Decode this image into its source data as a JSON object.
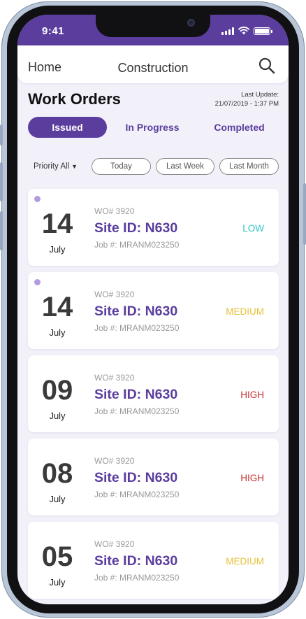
{
  "status_bar": {
    "time": "9:41"
  },
  "header": {
    "home": "Home",
    "title": "Construction"
  },
  "page": {
    "title": "Work Orders",
    "last_update_label": "Last Update:",
    "last_update_value": "21/07/2019 - 1:37 PM"
  },
  "tabs": [
    {
      "label": "Issued",
      "active": true
    },
    {
      "label": "In Progress",
      "active": false
    },
    {
      "label": "Completed",
      "active": false
    }
  ],
  "filters": {
    "priority_label": "Priority All",
    "chips": [
      "Today",
      "Last Week",
      "Last Month"
    ]
  },
  "colors": {
    "brand": "#5b3d9e",
    "low": "#2ec4c6",
    "medium": "#e6c23a",
    "high": "#c7302f",
    "unread": "#b39be0"
  },
  "orders": [
    {
      "day": "14",
      "month": "July",
      "wo": "WO# 3920",
      "site": "Site ID: N630",
      "job": "Job #: MRANM023250",
      "priority": "LOW",
      "priority_color": "#2ec4c6",
      "unread": true
    },
    {
      "day": "14",
      "month": "July",
      "wo": "WO# 3920",
      "site": "Site ID: N630",
      "job": "Job #: MRANM023250",
      "priority": "MEDIUM",
      "priority_color": "#e6c23a",
      "unread": true
    },
    {
      "day": "09",
      "month": "July",
      "wo": "WO# 3920",
      "site": "Site ID: N630",
      "job": "Job #: MRANM023250",
      "priority": "HIGH",
      "priority_color": "#c7302f",
      "unread": false
    },
    {
      "day": "08",
      "month": "July",
      "wo": "WO# 3920",
      "site": "Site ID: N630",
      "job": "Job #: MRANM023250",
      "priority": "HIGH",
      "priority_color": "#c7302f",
      "unread": false
    },
    {
      "day": "05",
      "month": "July",
      "wo": "WO# 3920",
      "site": "Site ID: N630",
      "job": "Job #: MRANM023250",
      "priority": "MEDIUM",
      "priority_color": "#e6c23a",
      "unread": false
    }
  ]
}
